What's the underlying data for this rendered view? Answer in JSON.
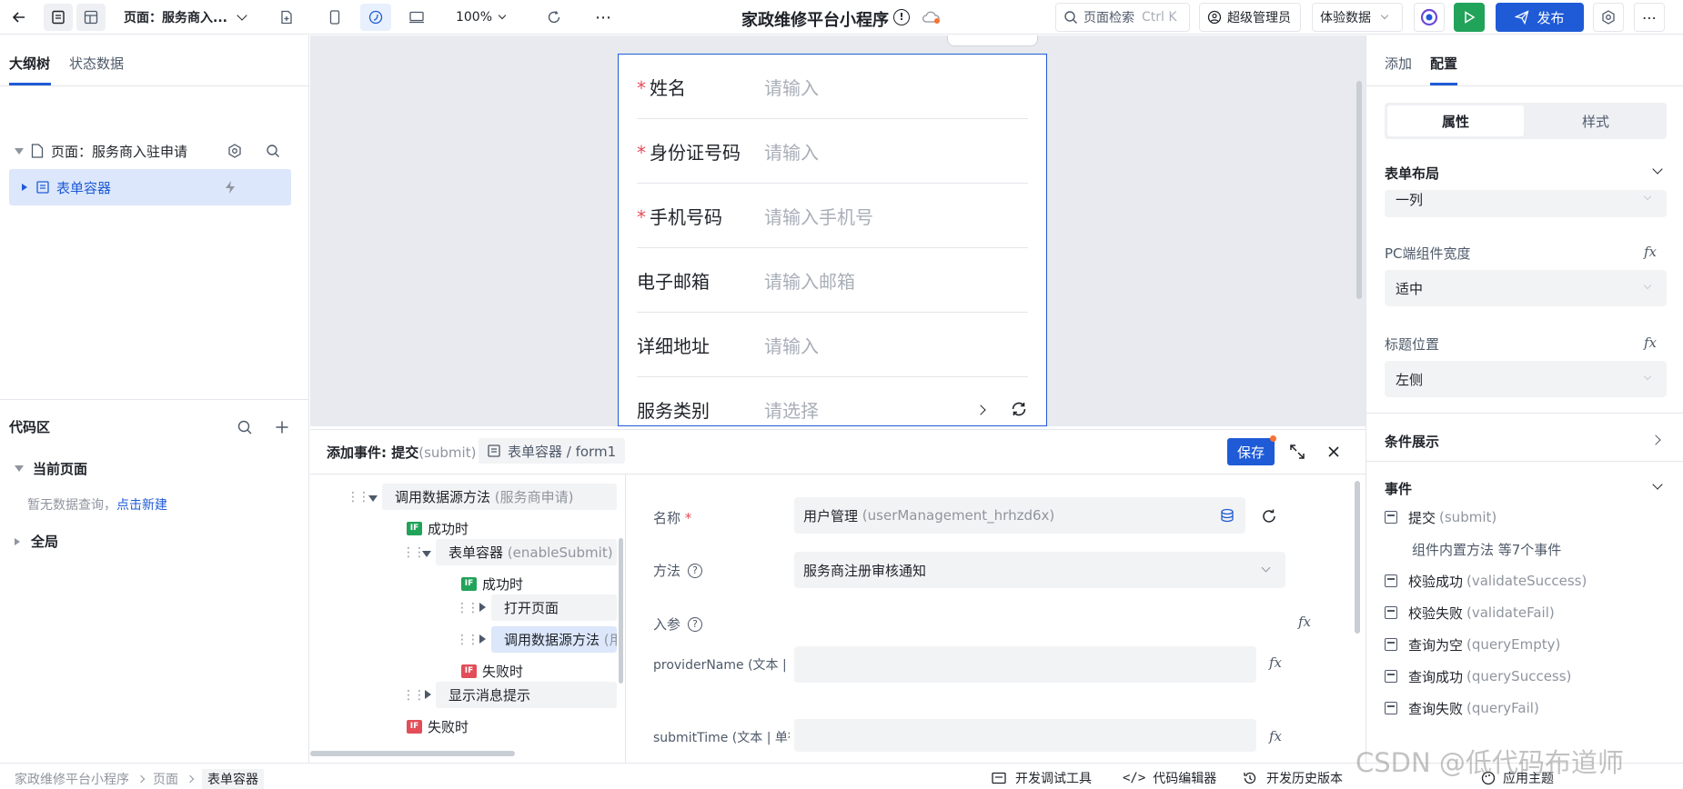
{
  "topbar": {
    "page_label": "页面：服务商入...",
    "zoom": "100%",
    "app_title": "家政维修平台小程序",
    "search_label": "页面检索",
    "search_shortcut": "Ctrl K",
    "role": "超级管理员",
    "data_mode": "体验数据",
    "publish": "发布"
  },
  "left": {
    "tabs": [
      "大纲树",
      "状态数据"
    ],
    "tree_page": "页面：服务商入驻申请",
    "tree_form": "表单容器",
    "code_title": "代码区",
    "current_page": "当前页面",
    "no_query": "暂无数据查询，",
    "create_new": "点击新建",
    "global": "全局"
  },
  "form": {
    "fields": [
      {
        "label": "姓名",
        "placeholder": "请输入",
        "required": true
      },
      {
        "label": "身份证号码",
        "placeholder": "请输入",
        "required": true
      },
      {
        "label": "手机号码",
        "placeholder": "请输入手机号",
        "required": true
      },
      {
        "label": "电子邮箱",
        "placeholder": "请输入邮箱",
        "required": false
      },
      {
        "label": "详细地址",
        "placeholder": "请输入",
        "required": false
      },
      {
        "label": "服务类别",
        "placeholder": "请选择",
        "required": false
      }
    ]
  },
  "event": {
    "title_prefix": "添加事件: 提交",
    "title_code": "(submit)",
    "crumb": "表单容器 / form1",
    "save": "保存",
    "tree": {
      "call_ds": "调用数据源方法",
      "call_ds_sub": "(服务商申请)",
      "success": "成功时",
      "form_container": "表单容器",
      "enable_submit": "(enableSubmit)",
      "success2": "成功时",
      "open_page": "打开页面",
      "call_ds2": "调用数据源方法",
      "call_ds2_sub": "(用",
      "fail": "失败时",
      "show_msg": "显示消息提示",
      "fail2": "失败时"
    },
    "config": {
      "name_label": "名称",
      "name_value": "用户管理",
      "name_code": "(userManagement_hrhzd6x)",
      "method_label": "方法",
      "method_value": "服务商注册审核通知",
      "params_label": "入参",
      "param1": "providerName (文本 | 单",
      "param2": "submitTime (文本 | 单行"
    }
  },
  "right": {
    "tabs": [
      "添加",
      "配置"
    ],
    "seg": [
      "属性",
      "样式"
    ],
    "form_layout": "表单布局",
    "layout_value": "一列",
    "pc_width": "PC端组件宽度",
    "pc_width_value": "适中",
    "title_pos": "标题位置",
    "title_pos_value": "左侧",
    "cond_show": "条件展示",
    "events": "事件",
    "event_list": [
      {
        "name": "提交",
        "code": "(submit)"
      },
      {
        "name": "组件内置方法 等7个事件",
        "code": ""
      },
      {
        "name": "校验成功",
        "code": "(validateSuccess)"
      },
      {
        "name": "校验失败",
        "code": "(validateFail)"
      },
      {
        "name": "查询为空",
        "code": "(queryEmpty)"
      },
      {
        "name": "查询成功",
        "code": "(querySuccess)"
      },
      {
        "name": "查询失败",
        "code": "(queryFail)"
      }
    ],
    "theme": "应用主题"
  },
  "status": {
    "crumbs": [
      "家政维修平台小程序",
      "页面",
      "表单容器"
    ],
    "dev_tools": "开发调试工具",
    "code_editor": "代码编辑器",
    "history": "开发历史版本"
  },
  "watermark": "CSDN @低代码布道师",
  "colors": {
    "accent": "#1f5bd6",
    "success": "#21a35a",
    "danger": "#e34d59"
  }
}
